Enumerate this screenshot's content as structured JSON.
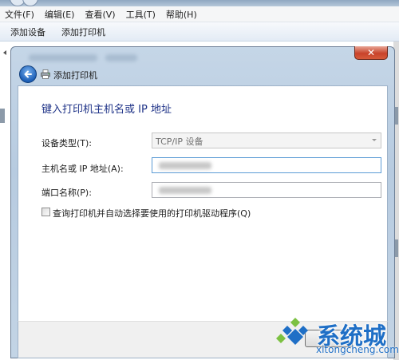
{
  "menubar": {
    "items": [
      {
        "label": "文件(F)"
      },
      {
        "label": "编辑(E)"
      },
      {
        "label": "查看(V)"
      },
      {
        "label": "工具(T)"
      },
      {
        "label": "帮助(H)"
      }
    ]
  },
  "toolbar": {
    "add_device_label": "添加设备",
    "add_printer_label": "添加打印机"
  },
  "dialog": {
    "close_glyph": "✕",
    "nav_title": "添加打印机",
    "heading": "键入打印机主机名或 IP 地址",
    "device_type": {
      "label": "设备类型(T):",
      "value": "TCP/IP 设备"
    },
    "hostname": {
      "label": "主机名或 IP 地址(A):"
    },
    "port_name": {
      "label": "端口名称(P):"
    },
    "query_driver": {
      "label": "查询打印机并自动选择要使用的打印机驱动程序(Q)",
      "checked": false
    }
  },
  "watermark": {
    "brand": "系统城",
    "url": "xitongcheng.com",
    "colors": {
      "blue": "#1f6fc6",
      "green": "#7cc142"
    }
  },
  "colors": {
    "heading": "#1e3287",
    "close_button": "#c8432a",
    "back_button": "#1d5fb7"
  }
}
